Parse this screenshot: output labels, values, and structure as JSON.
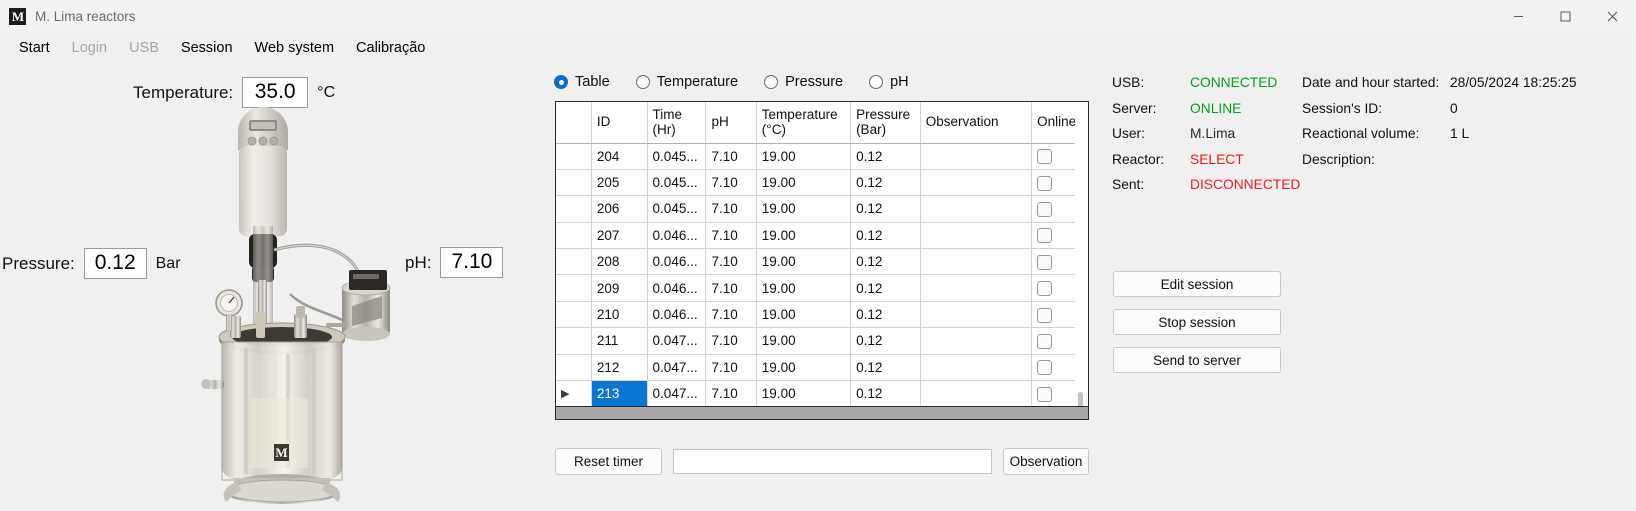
{
  "window": {
    "title": "M. Lima reactors",
    "icon": "M",
    "controls": [
      {
        "name": "minimize",
        "glyph": "minimize-icon"
      },
      {
        "name": "maximize",
        "glyph": "maximize-icon"
      },
      {
        "name": "close",
        "glyph": "close-icon"
      }
    ]
  },
  "menu": {
    "items": [
      {
        "label": "Start",
        "disabled": false
      },
      {
        "label": "Login",
        "disabled": true
      },
      {
        "label": "USB",
        "disabled": true
      },
      {
        "label": "Session",
        "disabled": false
      },
      {
        "label": "Web system",
        "disabled": false
      },
      {
        "label": "Calibração",
        "disabled": false
      }
    ]
  },
  "readouts": {
    "temperature": {
      "label": "Temperature:",
      "value": "35.0",
      "unit": "°C"
    },
    "pressure": {
      "label": "Pressure:",
      "value": "0.12",
      "unit": "Bar"
    },
    "ph": {
      "label": "pH:",
      "value": "7.10",
      "unit": ""
    }
  },
  "photo": {
    "alt": "bioreactor-photo"
  },
  "view_modes": {
    "selected": "Table",
    "options": [
      {
        "label": "Table",
        "selected": true
      },
      {
        "label": "Temperature",
        "selected": false
      },
      {
        "label": "Pressure",
        "selected": false
      },
      {
        "label": "pH",
        "selected": false
      }
    ]
  },
  "table": {
    "columns": [
      {
        "key": "sel",
        "label": ""
      },
      {
        "key": "id",
        "label": "ID"
      },
      {
        "key": "time",
        "label": "Time",
        "label2": "(Hr)"
      },
      {
        "key": "ph",
        "label": "pH"
      },
      {
        "key": "temperature",
        "label": "Temperature",
        "label2": "(°C)"
      },
      {
        "key": "pressure",
        "label": "Pressure",
        "label2": "(Bar)"
      },
      {
        "key": "observation",
        "label": "Observation"
      },
      {
        "key": "online",
        "label": "Online"
      }
    ],
    "selected_row_id": "213",
    "rows": [
      {
        "marker": "",
        "id": "204",
        "time": "0.045...",
        "ph": "7.10",
        "temperature": "19.00",
        "pressure": "0.12",
        "observation": "",
        "online": false,
        "selected": false
      },
      {
        "marker": "",
        "id": "205",
        "time": "0.045...",
        "ph": "7.10",
        "temperature": "19.00",
        "pressure": "0.12",
        "observation": "",
        "online": false,
        "selected": false
      },
      {
        "marker": "",
        "id": "206",
        "time": "0.045...",
        "ph": "7.10",
        "temperature": "19.00",
        "pressure": "0.12",
        "observation": "",
        "online": false,
        "selected": false
      },
      {
        "marker": "",
        "id": "207",
        "time": "0.046...",
        "ph": "7.10",
        "temperature": "19.00",
        "pressure": "0.12",
        "observation": "",
        "online": false,
        "selected": false
      },
      {
        "marker": "",
        "id": "208",
        "time": "0.046...",
        "ph": "7.10",
        "temperature": "19.00",
        "pressure": "0.12",
        "observation": "",
        "online": false,
        "selected": false
      },
      {
        "marker": "",
        "id": "209",
        "time": "0.046...",
        "ph": "7.10",
        "temperature": "19.00",
        "pressure": "0.12",
        "observation": "",
        "online": false,
        "selected": false
      },
      {
        "marker": "",
        "id": "210",
        "time": "0.046...",
        "ph": "7.10",
        "temperature": "19.00",
        "pressure": "0.12",
        "observation": "",
        "online": false,
        "selected": false
      },
      {
        "marker": "",
        "id": "211",
        "time": "0.047...",
        "ph": "7.10",
        "temperature": "19.00",
        "pressure": "0.12",
        "observation": "",
        "online": false,
        "selected": false
      },
      {
        "marker": "",
        "id": "212",
        "time": "0.047...",
        "ph": "7.10",
        "temperature": "19.00",
        "pressure": "0.12",
        "observation": "",
        "online": false,
        "selected": false
      },
      {
        "marker": "▶",
        "id": "213",
        "time": "0.047...",
        "ph": "7.10",
        "temperature": "19.00",
        "pressure": "0.12",
        "observation": "",
        "online": false,
        "selected": true
      },
      {
        "marker": "✱",
        "id": "",
        "time": "",
        "ph": "",
        "temperature": "",
        "pressure": "",
        "observation": "",
        "online": false,
        "selected": false
      }
    ]
  },
  "bottom_bar": {
    "reset_timer_label": "Reset timer",
    "observation_input_value": "",
    "observation_input_placeholder": "",
    "observation_label": "Observation"
  },
  "status": {
    "rows": [
      {
        "key": "USB:",
        "value": "CONNECTED",
        "color": "green"
      },
      {
        "key": "Server:",
        "value": "ONLINE",
        "color": "green"
      },
      {
        "key": "User:",
        "value": "M.Lima",
        "color": "plain"
      },
      {
        "key": "Reactor:",
        "value": "SELECT",
        "color": "red"
      },
      {
        "key": "Sent:",
        "value": "DISCONNECTED",
        "color": "red"
      }
    ]
  },
  "session_info": {
    "rows": [
      {
        "key": "Date and hour started:",
        "value": "28/05/2024 18:25:25"
      },
      {
        "key": "Session's ID:",
        "value": "0"
      },
      {
        "key": "Reactional volume:",
        "value": "1 L"
      },
      {
        "key": "Description:",
        "value": ""
      }
    ]
  },
  "actions": {
    "buttons": [
      {
        "label": "Edit session"
      },
      {
        "label": "Stop session"
      },
      {
        "label": "Send to server"
      }
    ]
  },
  "colors": {
    "accent_selection": "#0b76d1",
    "status_ok": "#0a9a24",
    "status_error": "#ec1c24",
    "window_bg": "#f0f0f0"
  }
}
